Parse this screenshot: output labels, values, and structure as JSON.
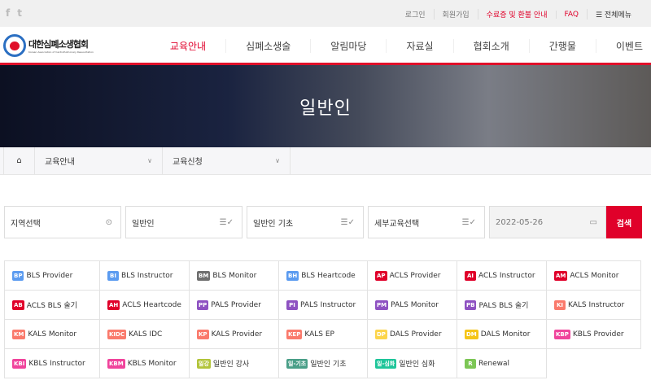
{
  "topbar": {
    "social": [
      "f",
      "t"
    ],
    "links": [
      "로그인",
      "회원가입",
      "수료증 및 환불 안내",
      "FAQ",
      "☰ 전체메뉴"
    ]
  },
  "logo": {
    "title": "대한심폐소생협회",
    "subtitle": "Korean Association of CardioPulmonary Resuscitation"
  },
  "nav": [
    "교육안내",
    "심폐소생술",
    "알림마당",
    "자료실",
    "협회소개",
    "간행물",
    "이벤트"
  ],
  "hero": {
    "title": "일반인"
  },
  "breadcrumb": {
    "home_icon": "home-icon",
    "items": [
      "교육안내",
      "교육신청"
    ]
  },
  "search": {
    "region": "지역선택",
    "category": "일반인",
    "course": "일반인 기초",
    "detail": "세부교육선택",
    "date": "2022-05-26",
    "button": "검색"
  },
  "courses": [
    {
      "badge": "BP",
      "label": "BLS Provider",
      "color": "#5b9bf0"
    },
    {
      "badge": "BI",
      "label": "BLS Instructor",
      "color": "#5b9bf0"
    },
    {
      "badge": "BM",
      "label": "BLS Monitor",
      "color": "#6f6f6f"
    },
    {
      "badge": "BH",
      "label": "BLS Heartcode",
      "color": "#5b9bf0"
    },
    {
      "badge": "AP",
      "label": "ACLS Provider",
      "color": "#e0002a"
    },
    {
      "badge": "AI",
      "label": "ACLS Instructor",
      "color": "#e0002a"
    },
    {
      "badge": "AM",
      "label": "ACLS Monitor",
      "color": "#e0002a"
    },
    {
      "badge": "AB",
      "label": "ACLS BLS 술기",
      "color": "#e0002a"
    },
    {
      "badge": "AH",
      "label": "ACLS Heartcode",
      "color": "#e0002a"
    },
    {
      "badge": "PP",
      "label": "PALS Provider",
      "color": "#8e52c2"
    },
    {
      "badge": "PI",
      "label": "PALS Instructor",
      "color": "#8e52c2"
    },
    {
      "badge": "PM",
      "label": "PALS Monitor",
      "color": "#8e52c2"
    },
    {
      "badge": "PB",
      "label": "PALS BLS 술기",
      "color": "#8e52c2"
    },
    {
      "badge": "KI",
      "label": "KALS Instructor",
      "color": "#fa7a6c"
    },
    {
      "badge": "KM",
      "label": "KALS Monitor",
      "color": "#fa7a6c"
    },
    {
      "badge": "KIDC",
      "label": "KALS IDC",
      "color": "#fa7a6c"
    },
    {
      "badge": "KP",
      "label": "KALS Provider",
      "color": "#fa7a6c"
    },
    {
      "badge": "KEP",
      "label": "KALS EP",
      "color": "#fa7a6c"
    },
    {
      "badge": "DP",
      "label": "DALS Provider",
      "color": "#fcd54c"
    },
    {
      "badge": "DM",
      "label": "DALS Monitor",
      "color": "#f5c518"
    },
    {
      "badge": "KBP",
      "label": "KBLS Provider",
      "color": "#f0449c"
    },
    {
      "badge": "KBI",
      "label": "KBLS Instructor",
      "color": "#f0449c"
    },
    {
      "badge": "KBM",
      "label": "KBLS Monitor",
      "color": "#f0449c"
    },
    {
      "badge": "일강",
      "label": "일반인 강사",
      "color": "#b2c43a"
    },
    {
      "badge": "일-기초",
      "label": "일반인 기초",
      "color": "#4a9f88"
    },
    {
      "badge": "일-심화",
      "label": "일반인 심화",
      "color": "#1fc59a"
    },
    {
      "badge": "R",
      "label": "Renewal",
      "color": "#7cc655"
    }
  ]
}
